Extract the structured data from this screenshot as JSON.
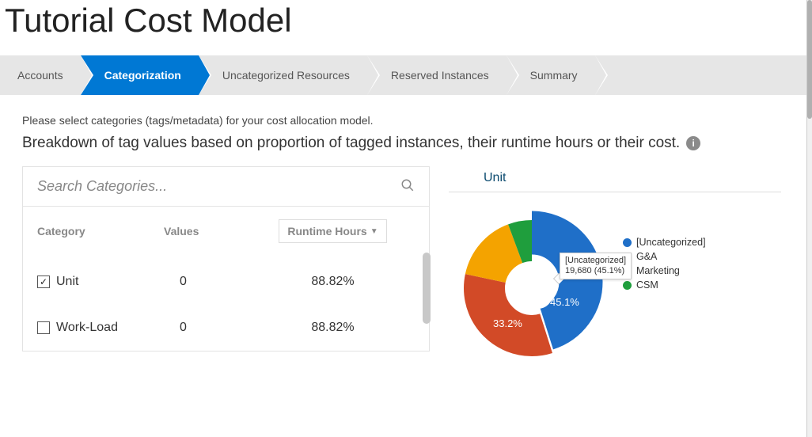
{
  "title": "Tutorial Cost Model",
  "steps": {
    "items": [
      {
        "label": "Accounts"
      },
      {
        "label": "Categorization"
      },
      {
        "label": "Uncategorized Resources"
      },
      {
        "label": "Reserved Instances"
      },
      {
        "label": "Summary"
      }
    ],
    "active_index": 1
  },
  "instructions": {
    "line1": "Please select categories (tags/metadata) for your cost allocation model.",
    "line2": "Breakdown of tag values based on proportion of tagged instances, their runtime hours or their cost."
  },
  "search": {
    "placeholder": "Search Categories..."
  },
  "table": {
    "headers": {
      "category": "Category",
      "values": "Values",
      "runtime": "Runtime Hours"
    },
    "rows": [
      {
        "checked": true,
        "name": "Unit",
        "values": "0",
        "runtime": "88.82%"
      },
      {
        "checked": false,
        "name": "Work-Load",
        "values": "0",
        "runtime": "88.82%"
      }
    ]
  },
  "chart_title": "Unit",
  "chart_data": {
    "type": "pie",
    "title": "Unit",
    "series": [
      {
        "name": "[Uncategorized]",
        "value": 19680,
        "percent": 45.1,
        "color": "#1f6fc8"
      },
      {
        "name": "G&A",
        "value": null,
        "percent": 33.2,
        "color": "#d24a27"
      },
      {
        "name": "Marketing",
        "value": null,
        "percent": 16.0,
        "color": "#f4a300"
      },
      {
        "name": "CSM",
        "value": null,
        "percent": 5.7,
        "color": "#1f9e3d"
      }
    ],
    "visible_slice_labels": [
      "45.1%",
      "33.2%"
    ],
    "tooltip": {
      "label": "[Uncategorized]",
      "value_text": "19,680 (45.1%)"
    },
    "legend_position": "right"
  },
  "colors": {
    "primary": "#0078d4"
  }
}
